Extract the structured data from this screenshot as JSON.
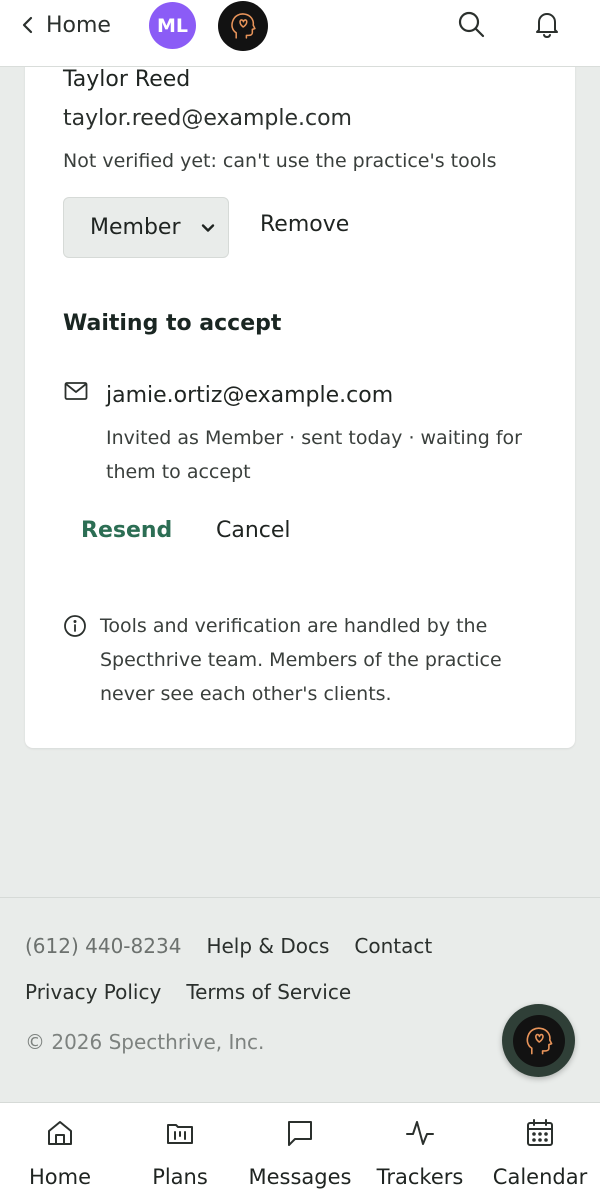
{
  "header": {
    "back_label": "Home",
    "avatar_initials": "ML",
    "avatar_color": "#8b5cf6"
  },
  "member": {
    "name": "Taylor Reed",
    "email": "taylor.reed@example.com",
    "status": "Not verified yet: can't use the practice's tools",
    "role_value": "Member",
    "remove_label": "Remove"
  },
  "pending": {
    "section_title": "Waiting to accept",
    "email": "jamie.ortiz@example.com",
    "meta": "Invited as Member · sent today · waiting for them to accept",
    "resend_label": "Resend",
    "cancel_label": "Cancel"
  },
  "info_note": "Tools and verification are handled by the Specthrive team. Members of the practice never see each other's clients.",
  "footer": {
    "phone": "(612) 440-8234",
    "help_label": "Help & Docs",
    "contact_label": "Contact",
    "privacy_label": "Privacy Policy",
    "terms_label": "Terms of Service",
    "copyright": "© 2026 Specthrive, Inc."
  },
  "tabs": [
    {
      "label": "Home",
      "icon": "home-icon"
    },
    {
      "label": "Plans",
      "icon": "plans-icon"
    },
    {
      "label": "Messages",
      "icon": "messages-icon"
    },
    {
      "label": "Trackers",
      "icon": "trackers-icon"
    },
    {
      "label": "Calendar",
      "icon": "calendar-icon"
    }
  ],
  "colors": {
    "accent_green": "#2c6e54",
    "page_bg": "#e9ecea",
    "logo_orange": "#e8945a"
  }
}
